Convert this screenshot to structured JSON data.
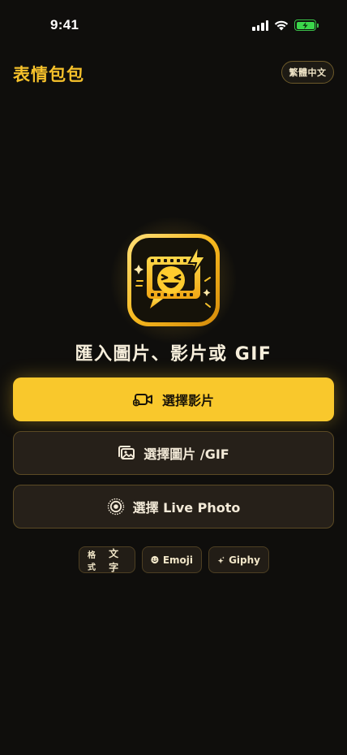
{
  "status_bar": {
    "time": "9:41"
  },
  "header": {
    "app_title": "表情包包",
    "language_button": "繁體中文"
  },
  "main": {
    "headline": "匯入圖片、影片或 GIF",
    "buttons": {
      "video": "選擇影片",
      "image": "選擇圖片 /GIF",
      "live": "選擇 Live Photo"
    },
    "chips": {
      "format_label": "格式",
      "text": "文字",
      "emoji": "Emoji",
      "giphy": "Giphy"
    }
  },
  "colors": {
    "accent": "#f9c82c",
    "background": "#0f0e0c",
    "battery": "#3bd74b"
  },
  "icons": [
    "camera-icon",
    "gallery-icon",
    "live-photo-icon",
    "emoji-icon",
    "sparkle-icon",
    "wifi-icon",
    "cellular-signal-icon",
    "battery-icon",
    "app-logo"
  ]
}
